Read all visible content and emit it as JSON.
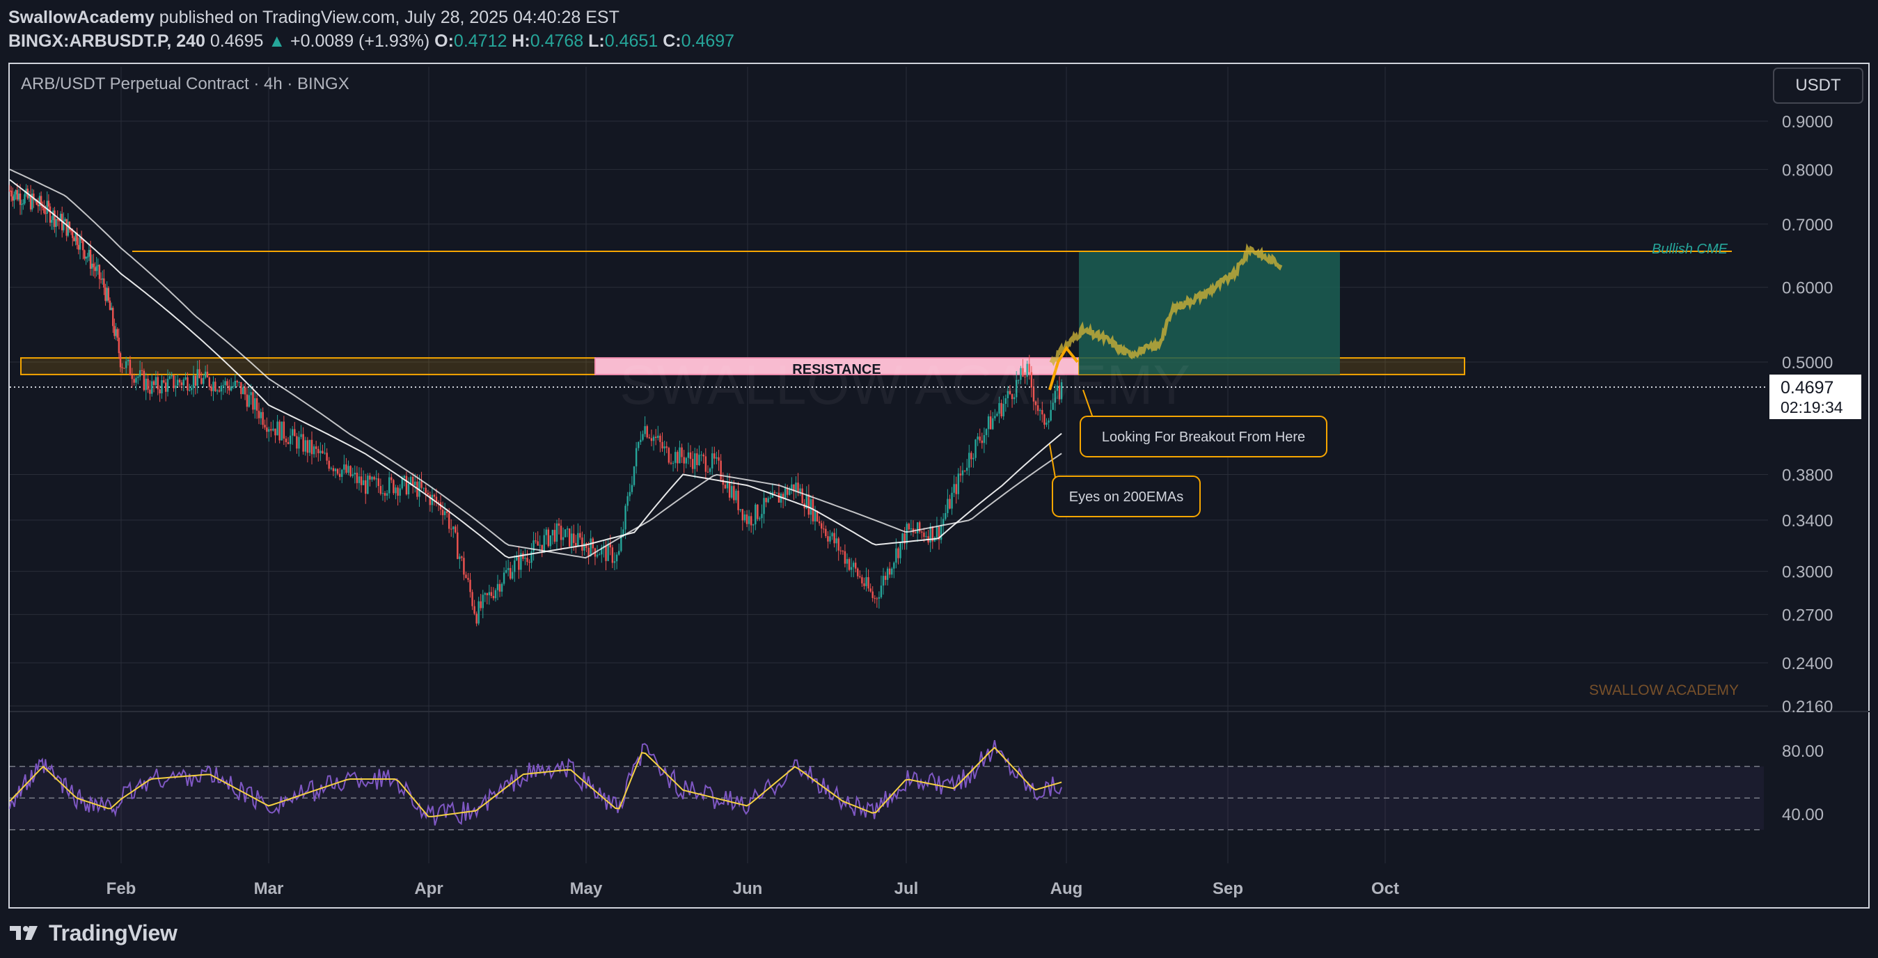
{
  "header": {
    "publisher": "SwallowAcademy",
    "published_text": "published on TradingView.com, July 28, 2025 04:40:28 EST",
    "symbol": "BINGX:ARBUSDT.P, 240",
    "last": "0.4695",
    "change": "+0.0089 (+1.93%)",
    "open_label": "O:",
    "open": "0.4712",
    "high_label": "H:",
    "high": "0.4768",
    "low_label": "L:",
    "low": "0.4651",
    "close_label": "C:",
    "close": "0.4697",
    "up_arrow": "▲"
  },
  "chart": {
    "legend": "ARB/USDT Perpetual Contract · 4h · BINGX",
    "currency": "USDT",
    "watermark": "SWALLOW ACADEMY",
    "brand_tag": "SWALLOW ACADEMY",
    "price_badge": "0.4697",
    "countdown": "02:19:34"
  },
  "annotations": {
    "resistance": "RESISTANCE",
    "bullish_cme": "Bullish CME",
    "breakout": "Looking For Breakout From Here",
    "ema": "Eyes on 200EMAs"
  },
  "colors": {
    "bg": "#131722",
    "grid": "#2a2e39",
    "up": "#26a69a",
    "down": "#ef5350",
    "orange": "#f7a600",
    "resistance_fill": "#f8bbd0",
    "target_fill": "#1b5e52",
    "projection": "#c9b037",
    "rsi": "#7e57c2",
    "rsi_ma": "#f5d142"
  },
  "footer": {
    "brand": "TradingView"
  },
  "chart_data": {
    "type": "candlestick",
    "symbol": "ARBUSDT.P",
    "timeframe": "4h",
    "y_scale": "log",
    "x_ticks": [
      "Feb",
      "Mar",
      "Apr",
      "May",
      "Jun",
      "Jul",
      "Aug",
      "Sep",
      "Oct"
    ],
    "y_ticks": [
      "0.9000",
      "0.8000",
      "0.7000",
      "0.6000",
      "0.5000",
      "0.3800",
      "0.3400",
      "0.3000",
      "0.2700",
      "0.2400",
      "0.2160"
    ],
    "y_tick_values": [
      0.9,
      0.8,
      0.7,
      0.6,
      0.5,
      0.38,
      0.34,
      0.3,
      0.27,
      0.24,
      0.216
    ],
    "price_path": [
      {
        "t": 0.0,
        "p": 0.76
      },
      {
        "t": 0.3,
        "p": 0.73
      },
      {
        "t": 0.6,
        "p": 0.68
      },
      {
        "t": 0.85,
        "p": 0.6
      },
      {
        "t": 1.0,
        "p": 0.5
      },
      {
        "t": 1.2,
        "p": 0.47
      },
      {
        "t": 1.5,
        "p": 0.48
      },
      {
        "t": 1.8,
        "p": 0.47
      },
      {
        "t": 2.0,
        "p": 0.43
      },
      {
        "t": 2.3,
        "p": 0.4
      },
      {
        "t": 2.6,
        "p": 0.37
      },
      {
        "t": 2.9,
        "p": 0.37
      },
      {
        "t": 3.1,
        "p": 0.35
      },
      {
        "t": 3.3,
        "p": 0.27
      },
      {
        "t": 3.5,
        "p": 0.3
      },
      {
        "t": 3.8,
        "p": 0.33
      },
      {
        "t": 4.0,
        "p": 0.32
      },
      {
        "t": 4.2,
        "p": 0.31
      },
      {
        "t": 4.35,
        "p": 0.43
      },
      {
        "t": 4.5,
        "p": 0.4
      },
      {
        "t": 4.8,
        "p": 0.39
      },
      {
        "t": 5.0,
        "p": 0.34
      },
      {
        "t": 5.3,
        "p": 0.37
      },
      {
        "t": 5.5,
        "p": 0.33
      },
      {
        "t": 5.8,
        "p": 0.28
      },
      {
        "t": 6.0,
        "p": 0.33
      },
      {
        "t": 6.2,
        "p": 0.33
      },
      {
        "t": 6.4,
        "p": 0.4
      },
      {
        "t": 6.6,
        "p": 0.45
      },
      {
        "t": 6.75,
        "p": 0.49
      },
      {
        "t": 6.85,
        "p": 0.43
      },
      {
        "t": 6.97,
        "p": 0.4697
      }
    ],
    "ema_fast_path": [
      {
        "t": 0.0,
        "p": 0.78
      },
      {
        "t": 1.0,
        "p": 0.62
      },
      {
        "t": 2.0,
        "p": 0.45
      },
      {
        "t": 2.6,
        "p": 0.4
      },
      {
        "t": 3.0,
        "p": 0.36
      },
      {
        "t": 3.5,
        "p": 0.31
      },
      {
        "t": 4.0,
        "p": 0.32
      },
      {
        "t": 4.3,
        "p": 0.33
      },
      {
        "t": 4.6,
        "p": 0.38
      },
      {
        "t": 5.0,
        "p": 0.37
      },
      {
        "t": 5.4,
        "p": 0.35
      },
      {
        "t": 5.8,
        "p": 0.32
      },
      {
        "t": 6.2,
        "p": 0.325
      },
      {
        "t": 6.6,
        "p": 0.37
      },
      {
        "t": 6.97,
        "p": 0.42
      }
    ],
    "ema_slow_path": [
      {
        "t": 0.0,
        "p": 0.8
      },
      {
        "t": 0.5,
        "p": 0.75
      },
      {
        "t": 1.0,
        "p": 0.66
      },
      {
        "t": 1.5,
        "p": 0.56
      },
      {
        "t": 2.0,
        "p": 0.48
      },
      {
        "t": 2.5,
        "p": 0.42
      },
      {
        "t": 3.0,
        "p": 0.37
      },
      {
        "t": 3.5,
        "p": 0.32
      },
      {
        "t": 4.0,
        "p": 0.31
      },
      {
        "t": 4.4,
        "p": 0.34
      },
      {
        "t": 4.8,
        "p": 0.38
      },
      {
        "t": 5.2,
        "p": 0.37
      },
      {
        "t": 5.6,
        "p": 0.35
      },
      {
        "t": 6.0,
        "p": 0.33
      },
      {
        "t": 6.4,
        "p": 0.34
      },
      {
        "t": 6.97,
        "p": 0.4
      }
    ],
    "projection_path": [
      {
        "t": 7.0,
        "p": 0.5
      },
      {
        "t": 7.2,
        "p": 0.54
      },
      {
        "t": 7.35,
        "p": 0.53
      },
      {
        "t": 7.5,
        "p": 0.51
      },
      {
        "t": 7.7,
        "p": 0.52
      },
      {
        "t": 7.8,
        "p": 0.57
      },
      {
        "t": 8.0,
        "p": 0.59
      },
      {
        "t": 8.2,
        "p": 0.62
      },
      {
        "t": 8.3,
        "p": 0.66
      },
      {
        "t": 8.4,
        "p": 0.645
      },
      {
        "t": 8.5,
        "p": 0.635
      }
    ],
    "resistance_zone": {
      "low": 0.485,
      "high": 0.505,
      "t_start": 0.1,
      "t_end": 8.95
    },
    "target_zone": {
      "low": 0.485,
      "high": 0.655,
      "t_start": 7.05,
      "t_end": 8.7
    },
    "cme_level": 0.655,
    "rsi_path": [
      {
        "t": 0.0,
        "v": 48
      },
      {
        "t": 0.3,
        "v": 70
      },
      {
        "t": 0.6,
        "v": 50
      },
      {
        "t": 0.9,
        "v": 43
      },
      {
        "t": 1.2,
        "v": 62
      },
      {
        "t": 1.6,
        "v": 65
      },
      {
        "t": 2.0,
        "v": 45
      },
      {
        "t": 2.5,
        "v": 62
      },
      {
        "t": 2.8,
        "v": 62
      },
      {
        "t": 3.0,
        "v": 38
      },
      {
        "t": 3.3,
        "v": 42
      },
      {
        "t": 3.6,
        "v": 65
      },
      {
        "t": 3.9,
        "v": 68
      },
      {
        "t": 4.2,
        "v": 42
      },
      {
        "t": 4.35,
        "v": 80
      },
      {
        "t": 4.6,
        "v": 55
      },
      {
        "t": 5.0,
        "v": 45
      },
      {
        "t": 5.3,
        "v": 70
      },
      {
        "t": 5.6,
        "v": 48
      },
      {
        "t": 5.8,
        "v": 40
      },
      {
        "t": 6.0,
        "v": 62
      },
      {
        "t": 6.3,
        "v": 56
      },
      {
        "t": 6.55,
        "v": 82
      },
      {
        "t": 6.8,
        "v": 55
      },
      {
        "t": 6.97,
        "v": 60
      }
    ],
    "rsi_ticks": [
      "80.00",
      "40.00"
    ],
    "rsi_levels": [
      70,
      50,
      30
    ]
  }
}
